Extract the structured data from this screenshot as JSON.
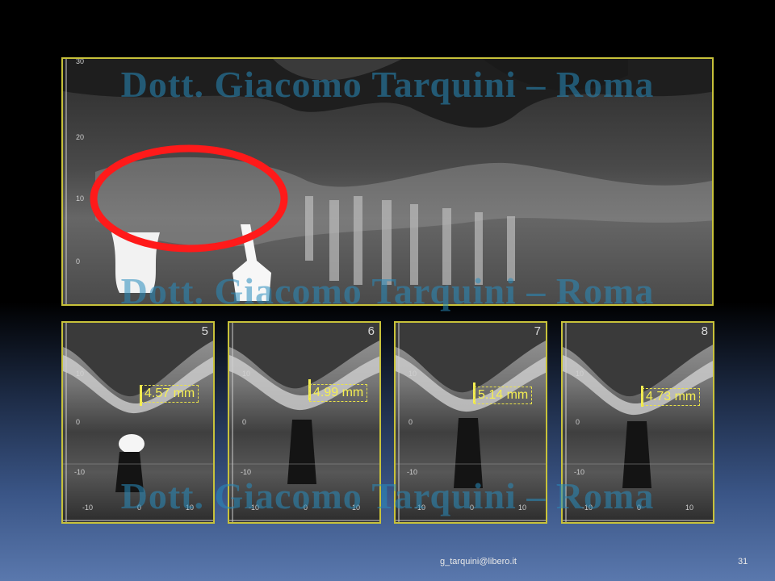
{
  "watermark": "Dott. Giacomo Tarquini – Roma",
  "panoramic": {
    "y_ticks": [
      "30",
      "20",
      "10",
      "0"
    ]
  },
  "cross_sections": [
    {
      "slice": "5",
      "measurement": "4.57 mm"
    },
    {
      "slice": "6",
      "measurement": "4.99 mm"
    },
    {
      "slice": "7",
      "measurement": "5.14 mm"
    },
    {
      "slice": "8",
      "measurement": "4.73 mm"
    }
  ],
  "cross_ticks": {
    "y": [
      "10",
      "0",
      "-10"
    ],
    "x": [
      "-10",
      "0",
      "10"
    ]
  },
  "colors": {
    "frame": "#c8c23a",
    "measure": "#f5ef52",
    "highlight": "#ff1a1a",
    "watermark": "#288cbe"
  },
  "footer": {
    "email": "g_tarquini@libero.it",
    "page": "31"
  }
}
